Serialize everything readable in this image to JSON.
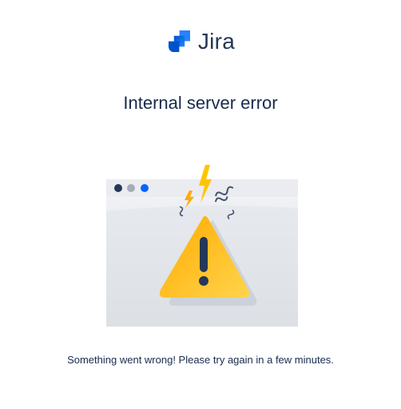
{
  "brand": {
    "name": "Jira",
    "logo_icon": "jira-logo-icon",
    "color": "#2684ff"
  },
  "error": {
    "title": "Internal server error",
    "message": "Something went wrong! Please try again in a few minutes."
  },
  "illustration": {
    "icon": "warning-triangle-icon",
    "browser_dot_colors": [
      "#253858",
      "#a5adba",
      "#0065ff"
    ],
    "warning_color": "#ffc400",
    "bolt_color": "#ffab00"
  }
}
